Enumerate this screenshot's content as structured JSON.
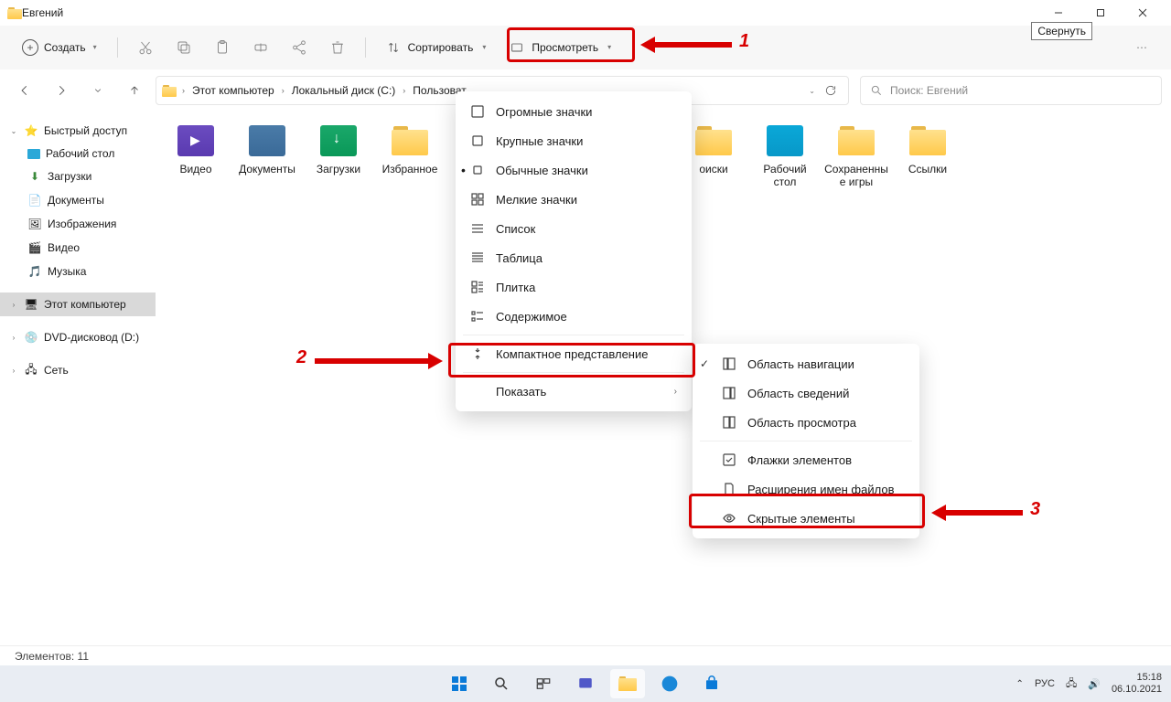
{
  "titlebar": {
    "title": "Евгений",
    "tooltip_minimize": "Свернуть"
  },
  "toolbar": {
    "create_label": "Создать",
    "sort_label": "Сортировать",
    "view_label": "Просмотреть"
  },
  "breadcrumb": {
    "segments": [
      "Этот компьютер",
      "Локальный диск (C:)",
      "Пользоват"
    ]
  },
  "search": {
    "placeholder": "Поиск: Евгений"
  },
  "sidebar": {
    "quick_access": "Быстрый доступ",
    "items": [
      {
        "label": "Рабочий стол"
      },
      {
        "label": "Загрузки"
      },
      {
        "label": "Документы"
      },
      {
        "label": "Изображения"
      },
      {
        "label": "Видео"
      },
      {
        "label": "Музыка"
      }
    ],
    "this_pc": "Этот компьютер",
    "dvd": "DVD-дисковод (D:)",
    "network": "Сеть"
  },
  "files": [
    {
      "label": "Видео",
      "type": "video"
    },
    {
      "label": "Документы",
      "type": "docs"
    },
    {
      "label": "Загрузки",
      "type": "downloads"
    },
    {
      "label": "Избранное",
      "type": "folder"
    },
    {
      "label": "оиски",
      "type": "folder"
    },
    {
      "label": "Рабочий стол",
      "type": "desktop"
    },
    {
      "label": "Сохраненные игры",
      "type": "folder"
    },
    {
      "label": "Ссылки",
      "type": "folder"
    }
  ],
  "view_menu": {
    "items": [
      "Огромные значки",
      "Крупные значки",
      "Обычные значки",
      "Мелкие значки",
      "Список",
      "Таблица",
      "Плитка",
      "Содержимое"
    ],
    "compact": "Компактное представление",
    "show": "Показать"
  },
  "show_submenu": {
    "nav_pane": "Область навигации",
    "details_pane": "Область сведений",
    "preview_pane": "Область просмотра",
    "checkboxes": "Флажки элементов",
    "extensions": "Расширения имен файлов",
    "hidden": "Скрытые элементы"
  },
  "annotations": {
    "n1": "1",
    "n2": "2",
    "n3": "3"
  },
  "status": {
    "count_label": "Элементов: 11"
  },
  "tray": {
    "lang": "РУС",
    "time": "15:18",
    "date": "06.10.2021"
  }
}
